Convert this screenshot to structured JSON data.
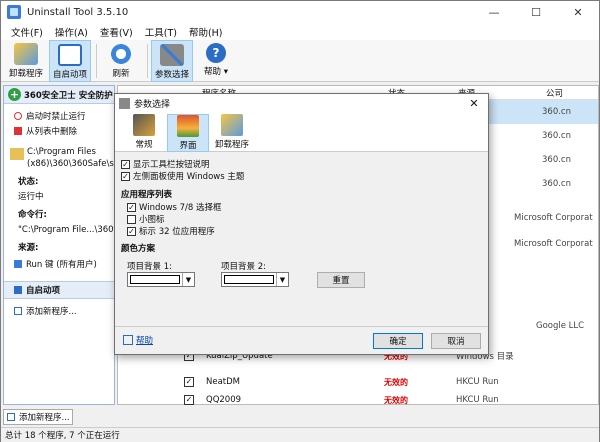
{
  "app": {
    "title": "Uninstall Tool 3.5.10",
    "win_min": "—",
    "win_max": "☐",
    "win_close": "✕"
  },
  "menu": [
    "文件(F)",
    "操作(A)",
    "查看(V)",
    "工具(T)",
    "帮助(H)"
  ],
  "toolbar": [
    {
      "label": "卸载程序",
      "icon": "uninstall-icon",
      "active": false
    },
    {
      "label": "自启动项",
      "icon": "startup-icon",
      "active": true
    },
    {
      "label": "刷新",
      "icon": "refresh-icon",
      "active": false
    },
    {
      "label": "参数选择",
      "icon": "settings-icon",
      "active": true
    },
    {
      "label": "帮助",
      "icon": "help-icon",
      "active": false
    }
  ],
  "left_panel": {
    "heading": "360安全卫士 安全防护",
    "actions": [
      "启动时禁止运行",
      "从列表中删除"
    ],
    "path": [
      "C:\\Program Files",
      "(x86)\\360\\360Safe\\sa"
    ],
    "state_label": "状态:",
    "state_value": "运行中",
    "cmd_label": "命令行:",
    "cmd_value": "\"C:\\Program File...\\360tra",
    "source_label": "来源:",
    "source_value": "Run 键 (所有用户)",
    "section2": "自启动项",
    "add_new": "添加新程序..."
  },
  "list": {
    "columns": {
      "name": "程序名称",
      "status": "状态",
      "source": "来源",
      "company": "公司"
    },
    "rows": [
      {
        "name": "",
        "status": "",
        "source": "",
        "company": "360.cn",
        "checked": true
      },
      {
        "name": "",
        "status": "",
        "source": "",
        "company": "360.cn",
        "checked": true
      },
      {
        "name": "",
        "status": "",
        "source": "",
        "company": "360.cn",
        "checked": true
      },
      {
        "name": "",
        "status": "",
        "source": "",
        "company": "360.cn",
        "checked": true
      },
      {
        "name": "",
        "status": "",
        "source": "",
        "company": "Microsoft Corporat",
        "checked": true
      },
      {
        "name": "",
        "status": "",
        "source": "",
        "company": "Microsoft Corporat",
        "checked": true
      },
      {
        "name": "",
        "status": "",
        "source": "",
        "company": "Google LLC",
        "checked": true
      },
      {
        "name": "KuaiZip_Update",
        "status": "无效的",
        "source": "Windows 目录",
        "company": "",
        "checked": true
      },
      {
        "name": "NeatDM",
        "status": "无效的",
        "source": "HKCU Run",
        "company": "",
        "checked": true
      },
      {
        "name": "QQ2009",
        "status": "无效的",
        "source": "HKCU Run",
        "company": "",
        "checked": true
      }
    ]
  },
  "statusbar": "总计 18 个程序, 7 个正在运行",
  "add_program_button": "添加新程序...",
  "dialog": {
    "title": "参数选择",
    "close": "✕",
    "tabs": [
      {
        "label": "常规",
        "icon": "general-icon",
        "active": false
      },
      {
        "label": "界面",
        "icon": "interface-icon",
        "active": true
      },
      {
        "label": "卸载程序",
        "icon": "uninstaller-icon",
        "active": false
      }
    ],
    "options_top": [
      {
        "label": "显示工具栏按钮说明",
        "checked": true
      },
      {
        "label": "左侧面板使用 Windows 主题",
        "checked": true
      }
    ],
    "app_list_heading": "应用程序列表",
    "options_list": [
      {
        "label": "Windows 7/8 选择框",
        "checked": true
      },
      {
        "label": "小图标",
        "checked": false
      },
      {
        "label": "标示 32 位应用程序",
        "checked": true
      }
    ],
    "color_heading": "颜色方案",
    "bg1_label": "项目背景 1:",
    "bg2_label": "项目背景 2:",
    "reset": "重置",
    "help": "帮助",
    "ok": "确定",
    "cancel": "取消"
  }
}
